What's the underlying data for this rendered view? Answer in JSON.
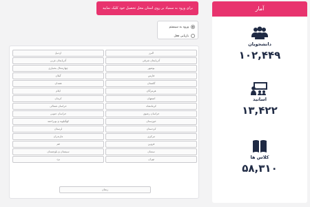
{
  "stats": {
    "header": "آمار",
    "students": {
      "label": "دانشجویان",
      "value": "۱۰۲,۴۴۹"
    },
    "teachers": {
      "label": "اساتید",
      "value": "۱۳,۴۲۲"
    },
    "classes": {
      "label": "کلاس ها",
      "value": "۵۸,۳۱۰"
    }
  },
  "alert": {
    "text": "برای ورود به سمیاد بر روی استان محل تحصیل خود کلیک نمایید"
  },
  "mode": {
    "options": [
      {
        "label": "ورود به سیستم",
        "checked": true
      },
      {
        "label": "بازیابی فعل",
        "checked": false
      }
    ]
  },
  "provinces": [
    "البرز",
    "اردبیل",
    "آذربایجان شرقی",
    "آذربایجان غربی",
    "بوشهر",
    "چهارمحال بختیاری",
    "فارس",
    "گیلان",
    "گلستان",
    "همدان",
    "هرمزگان",
    "ایلام",
    "اصفهان",
    "کرمان",
    "کرمانشاه",
    "خراسان شمالی",
    "خراسان رضوی",
    "خراسان جنوبی",
    "خوزستان",
    "کهگیلویه و بویراحمد",
    "کردستان",
    "لرستان",
    "مرکزی",
    "مازندران",
    "قزوین",
    "قم",
    "سمنان",
    "سیستان و بلوچستان",
    "تهران",
    "یزد",
    "زنجان"
  ]
}
